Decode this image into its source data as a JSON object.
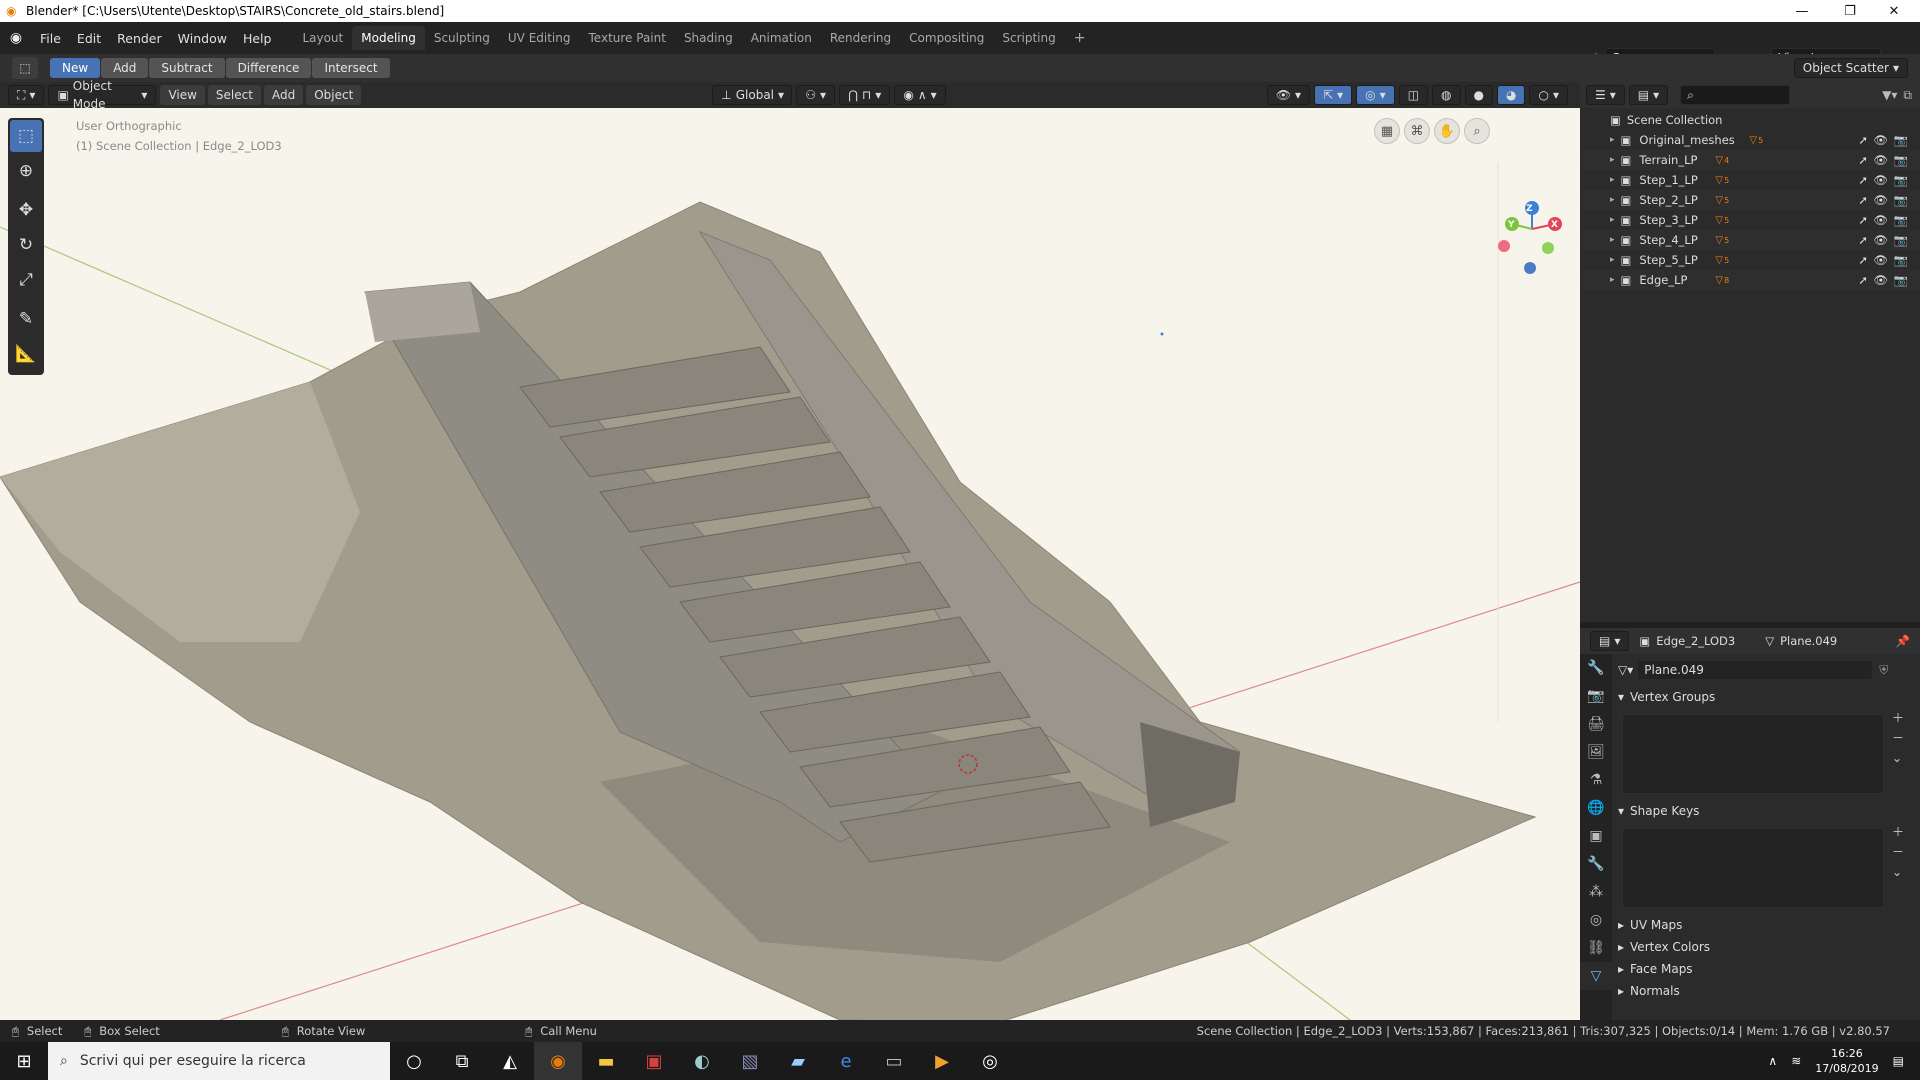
{
  "window": {
    "title": "Blender* [C:\\Users\\Utente\\Desktop\\STAIRS\\Concrete_old_stairs.blend]"
  },
  "menu": [
    "File",
    "Edit",
    "Render",
    "Window",
    "Help"
  ],
  "workspaces": [
    "Layout",
    "Modeling",
    "Sculpting",
    "UV Editing",
    "Texture Paint",
    "Shading",
    "Animation",
    "Rendering",
    "Compositing",
    "Scripting"
  ],
  "active_workspace": "Modeling",
  "scene": {
    "name": "Scene",
    "view_layer": "View Layer"
  },
  "toolsettings": {
    "boolean_buttons": [
      "New",
      "Add",
      "Subtract",
      "Difference",
      "Intersect"
    ],
    "active_boolean": "New",
    "right_menu": "Object Scatter"
  },
  "viewport_header": {
    "mode": "Object Mode",
    "menus": [
      "View",
      "Select",
      "Add",
      "Object"
    ],
    "orientation": "Global"
  },
  "viewport": {
    "view_name": "User Orthographic",
    "context": "(1) Scene Collection | Edge_2_LOD3",
    "gizmo_axes": [
      "X",
      "Y",
      "Z"
    ]
  },
  "outliner": {
    "root": "Scene Collection",
    "items": [
      {
        "name": "Original_meshes",
        "badge": "5"
      },
      {
        "name": "Terrain_LP",
        "badge": "4"
      },
      {
        "name": "Step_1_LP",
        "badge": "5"
      },
      {
        "name": "Step_2_LP",
        "badge": "5"
      },
      {
        "name": "Step_3_LP",
        "badge": "5"
      },
      {
        "name": "Step_4_LP",
        "badge": "5"
      },
      {
        "name": "Step_5_LP",
        "badge": "5"
      },
      {
        "name": "Edge_LP",
        "badge": "8"
      }
    ]
  },
  "properties": {
    "object": "Edge_2_LOD3",
    "mesh": "Plane.049",
    "datablock": "Plane.049",
    "panels_open": [
      "Vertex Groups",
      "Shape Keys"
    ],
    "panels_closed": [
      "UV Maps",
      "Vertex Colors",
      "Face Maps",
      "Normals"
    ]
  },
  "statusbar": {
    "left": [
      "Select",
      "Box Select",
      "Rotate View",
      "Call Menu"
    ],
    "stats": "Scene Collection | Edge_2_LOD3 | Verts:153,867 | Faces:213,861 | Tris:307,325 | Objects:0/14 | Mem: 1.76 GB | v2.80.57"
  },
  "taskbar": {
    "search_placeholder": "Scrivi qui per eseguire la ricerca",
    "time": "16:26",
    "date": "17/08/2019"
  },
  "colors": {
    "accent": "#4772b3",
    "viewport_bg": "#f7f4ec",
    "x_axis": "#e0455a",
    "y_axis": "#7cc43b",
    "z_axis": "#3b82d6"
  }
}
